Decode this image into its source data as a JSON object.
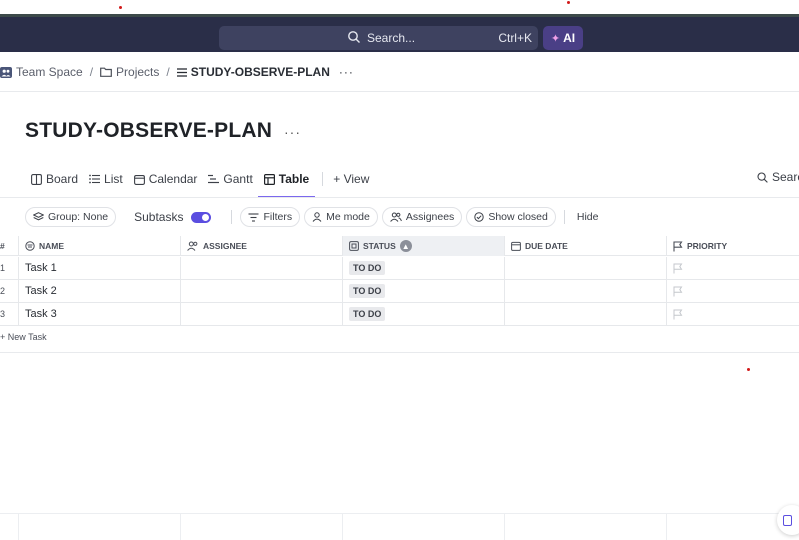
{
  "topbar": {
    "search_placeholder": "Search...",
    "search_shortcut": "Ctrl+K",
    "ai_label": "AI"
  },
  "breadcrumb": {
    "items": [
      "Team Space",
      "Projects",
      "STUDY-OBSERVE-PLAN"
    ],
    "separator": "/",
    "more": "···"
  },
  "page": {
    "title": "STUDY-OBSERVE-PLAN",
    "title_more": "···"
  },
  "views": {
    "tabs": [
      {
        "label": "Board",
        "icon": "board-icon"
      },
      {
        "label": "List",
        "icon": "list-icon"
      },
      {
        "label": "Calendar",
        "icon": "calendar-icon"
      },
      {
        "label": "Gantt",
        "icon": "gantt-icon"
      },
      {
        "label": "Table",
        "icon": "table-icon",
        "active": true
      }
    ],
    "add_view": "+ View",
    "search_label": "Searc"
  },
  "toolbar": {
    "group": "Group: None",
    "subtasks": "Subtasks",
    "subtasks_on": true,
    "filters": "Filters",
    "me_mode": "Me mode",
    "assignees": "Assignees",
    "show_closed": "Show closed",
    "hide": "Hide"
  },
  "table": {
    "row_number_header": "#",
    "columns": [
      "NAME",
      "ASSIGNEE",
      "STATUS",
      "DUE DATE",
      "PRIORITY"
    ],
    "rows": [
      {
        "num": "1",
        "name": "Task 1",
        "assignee": "",
        "status": "TO DO",
        "due": "",
        "priority": ""
      },
      {
        "num": "2",
        "name": "Task 2",
        "assignee": "",
        "status": "TO DO",
        "due": "",
        "priority": ""
      },
      {
        "num": "3",
        "name": "Task 3",
        "assignee": "",
        "status": "TO DO",
        "due": "",
        "priority": ""
      }
    ],
    "new_task": "+ New Task"
  },
  "colors": {
    "topbar": "#2a2e48",
    "accent": "#7b68ee",
    "toggle": "#5b4ee0"
  }
}
